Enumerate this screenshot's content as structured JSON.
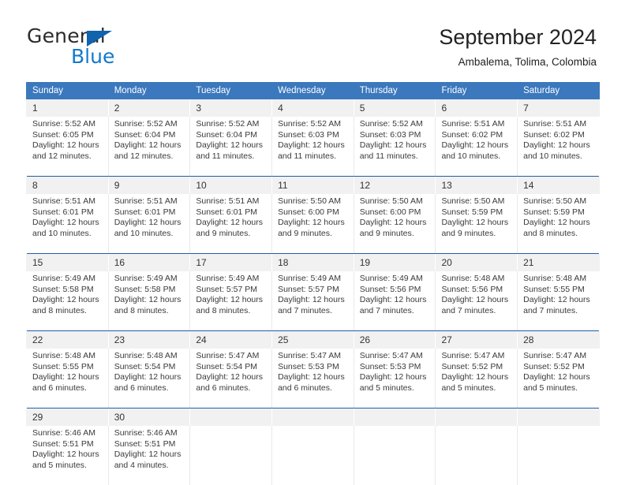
{
  "brand": {
    "name_part1": "General",
    "name_part2": "Blue",
    "triangle_icon": "blue-triangle-icon",
    "color_dark": "#2b2b2b",
    "color_blue": "#1379cc"
  },
  "header": {
    "title": "September 2024",
    "subtitle": "Ambalema, Tolima, Colombia"
  },
  "theme": {
    "header_bg": "#3b78bd",
    "header_text": "#ffffff",
    "daynum_bg": "#f1f1f1",
    "row_divider": "#1f5fa6",
    "cell_text": "#3a3a3a"
  },
  "columns": [
    "Sunday",
    "Monday",
    "Tuesday",
    "Wednesday",
    "Thursday",
    "Friday",
    "Saturday"
  ],
  "weeks": [
    {
      "days": [
        {
          "num": "1",
          "sunrise": "Sunrise: 5:52 AM",
          "sunset": "Sunset: 6:05 PM",
          "daylight1": "Daylight: 12 hours",
          "daylight2": "and 12 minutes."
        },
        {
          "num": "2",
          "sunrise": "Sunrise: 5:52 AM",
          "sunset": "Sunset: 6:04 PM",
          "daylight1": "Daylight: 12 hours",
          "daylight2": "and 12 minutes."
        },
        {
          "num": "3",
          "sunrise": "Sunrise: 5:52 AM",
          "sunset": "Sunset: 6:04 PM",
          "daylight1": "Daylight: 12 hours",
          "daylight2": "and 11 minutes."
        },
        {
          "num": "4",
          "sunrise": "Sunrise: 5:52 AM",
          "sunset": "Sunset: 6:03 PM",
          "daylight1": "Daylight: 12 hours",
          "daylight2": "and 11 minutes."
        },
        {
          "num": "5",
          "sunrise": "Sunrise: 5:52 AM",
          "sunset": "Sunset: 6:03 PM",
          "daylight1": "Daylight: 12 hours",
          "daylight2": "and 11 minutes."
        },
        {
          "num": "6",
          "sunrise": "Sunrise: 5:51 AM",
          "sunset": "Sunset: 6:02 PM",
          "daylight1": "Daylight: 12 hours",
          "daylight2": "and 10 minutes."
        },
        {
          "num": "7",
          "sunrise": "Sunrise: 5:51 AM",
          "sunset": "Sunset: 6:02 PM",
          "daylight1": "Daylight: 12 hours",
          "daylight2": "and 10 minutes."
        }
      ]
    },
    {
      "days": [
        {
          "num": "8",
          "sunrise": "Sunrise: 5:51 AM",
          "sunset": "Sunset: 6:01 PM",
          "daylight1": "Daylight: 12 hours",
          "daylight2": "and 10 minutes."
        },
        {
          "num": "9",
          "sunrise": "Sunrise: 5:51 AM",
          "sunset": "Sunset: 6:01 PM",
          "daylight1": "Daylight: 12 hours",
          "daylight2": "and 10 minutes."
        },
        {
          "num": "10",
          "sunrise": "Sunrise: 5:51 AM",
          "sunset": "Sunset: 6:01 PM",
          "daylight1": "Daylight: 12 hours",
          "daylight2": "and 9 minutes."
        },
        {
          "num": "11",
          "sunrise": "Sunrise: 5:50 AM",
          "sunset": "Sunset: 6:00 PM",
          "daylight1": "Daylight: 12 hours",
          "daylight2": "and 9 minutes."
        },
        {
          "num": "12",
          "sunrise": "Sunrise: 5:50 AM",
          "sunset": "Sunset: 6:00 PM",
          "daylight1": "Daylight: 12 hours",
          "daylight2": "and 9 minutes."
        },
        {
          "num": "13",
          "sunrise": "Sunrise: 5:50 AM",
          "sunset": "Sunset: 5:59 PM",
          "daylight1": "Daylight: 12 hours",
          "daylight2": "and 9 minutes."
        },
        {
          "num": "14",
          "sunrise": "Sunrise: 5:50 AM",
          "sunset": "Sunset: 5:59 PM",
          "daylight1": "Daylight: 12 hours",
          "daylight2": "and 8 minutes."
        }
      ]
    },
    {
      "days": [
        {
          "num": "15",
          "sunrise": "Sunrise: 5:49 AM",
          "sunset": "Sunset: 5:58 PM",
          "daylight1": "Daylight: 12 hours",
          "daylight2": "and 8 minutes."
        },
        {
          "num": "16",
          "sunrise": "Sunrise: 5:49 AM",
          "sunset": "Sunset: 5:58 PM",
          "daylight1": "Daylight: 12 hours",
          "daylight2": "and 8 minutes."
        },
        {
          "num": "17",
          "sunrise": "Sunrise: 5:49 AM",
          "sunset": "Sunset: 5:57 PM",
          "daylight1": "Daylight: 12 hours",
          "daylight2": "and 8 minutes."
        },
        {
          "num": "18",
          "sunrise": "Sunrise: 5:49 AM",
          "sunset": "Sunset: 5:57 PM",
          "daylight1": "Daylight: 12 hours",
          "daylight2": "and 7 minutes."
        },
        {
          "num": "19",
          "sunrise": "Sunrise: 5:49 AM",
          "sunset": "Sunset: 5:56 PM",
          "daylight1": "Daylight: 12 hours",
          "daylight2": "and 7 minutes."
        },
        {
          "num": "20",
          "sunrise": "Sunrise: 5:48 AM",
          "sunset": "Sunset: 5:56 PM",
          "daylight1": "Daylight: 12 hours",
          "daylight2": "and 7 minutes."
        },
        {
          "num": "21",
          "sunrise": "Sunrise: 5:48 AM",
          "sunset": "Sunset: 5:55 PM",
          "daylight1": "Daylight: 12 hours",
          "daylight2": "and 7 minutes."
        }
      ]
    },
    {
      "days": [
        {
          "num": "22",
          "sunrise": "Sunrise: 5:48 AM",
          "sunset": "Sunset: 5:55 PM",
          "daylight1": "Daylight: 12 hours",
          "daylight2": "and 6 minutes."
        },
        {
          "num": "23",
          "sunrise": "Sunrise: 5:48 AM",
          "sunset": "Sunset: 5:54 PM",
          "daylight1": "Daylight: 12 hours",
          "daylight2": "and 6 minutes."
        },
        {
          "num": "24",
          "sunrise": "Sunrise: 5:47 AM",
          "sunset": "Sunset: 5:54 PM",
          "daylight1": "Daylight: 12 hours",
          "daylight2": "and 6 minutes."
        },
        {
          "num": "25",
          "sunrise": "Sunrise: 5:47 AM",
          "sunset": "Sunset: 5:53 PM",
          "daylight1": "Daylight: 12 hours",
          "daylight2": "and 6 minutes."
        },
        {
          "num": "26",
          "sunrise": "Sunrise: 5:47 AM",
          "sunset": "Sunset: 5:53 PM",
          "daylight1": "Daylight: 12 hours",
          "daylight2": "and 5 minutes."
        },
        {
          "num": "27",
          "sunrise": "Sunrise: 5:47 AM",
          "sunset": "Sunset: 5:52 PM",
          "daylight1": "Daylight: 12 hours",
          "daylight2": "and 5 minutes."
        },
        {
          "num": "28",
          "sunrise": "Sunrise: 5:47 AM",
          "sunset": "Sunset: 5:52 PM",
          "daylight1": "Daylight: 12 hours",
          "daylight2": "and 5 minutes."
        }
      ]
    },
    {
      "days": [
        {
          "num": "29",
          "sunrise": "Sunrise: 5:46 AM",
          "sunset": "Sunset: 5:51 PM",
          "daylight1": "Daylight: 12 hours",
          "daylight2": "and 5 minutes."
        },
        {
          "num": "30",
          "sunrise": "Sunrise: 5:46 AM",
          "sunset": "Sunset: 5:51 PM",
          "daylight1": "Daylight: 12 hours",
          "daylight2": "and 4 minutes."
        },
        {
          "num": "",
          "sunrise": "",
          "sunset": "",
          "daylight1": "",
          "daylight2": ""
        },
        {
          "num": "",
          "sunrise": "",
          "sunset": "",
          "daylight1": "",
          "daylight2": ""
        },
        {
          "num": "",
          "sunrise": "",
          "sunset": "",
          "daylight1": "",
          "daylight2": ""
        },
        {
          "num": "",
          "sunrise": "",
          "sunset": "",
          "daylight1": "",
          "daylight2": ""
        },
        {
          "num": "",
          "sunrise": "",
          "sunset": "",
          "daylight1": "",
          "daylight2": ""
        }
      ]
    }
  ]
}
